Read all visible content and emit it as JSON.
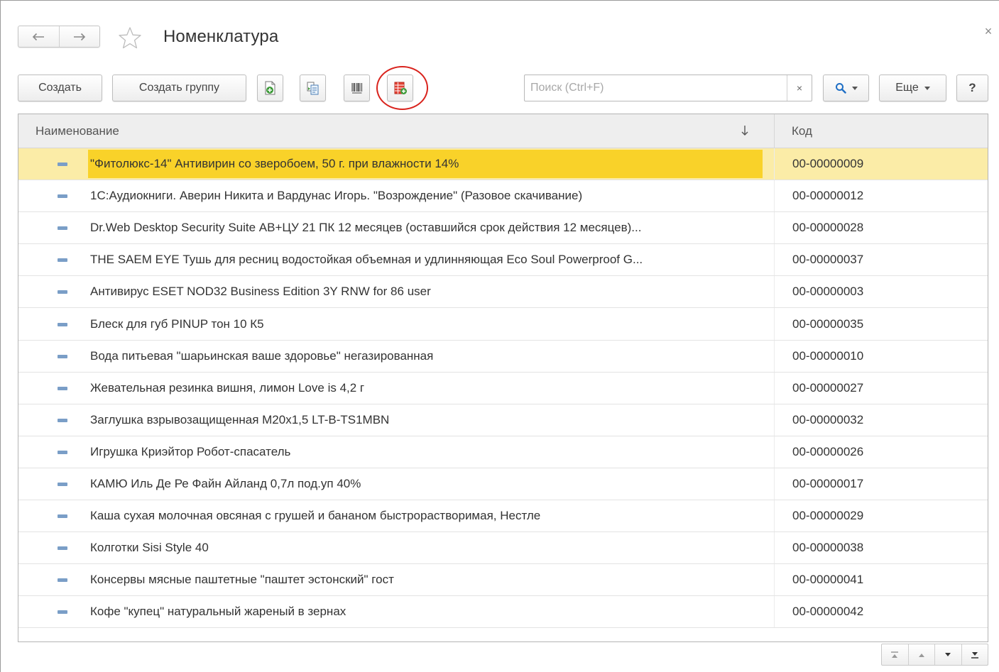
{
  "window": {
    "title": "Номенклатура",
    "close_label": "×"
  },
  "toolbar": {
    "create_label": "Создать",
    "create_group_label": "Создать группу",
    "search_placeholder": "Поиск (Ctrl+F)",
    "search_clear_label": "×",
    "more_label": "Еще",
    "help_label": "?"
  },
  "icons": {
    "back": "arrow-left-icon",
    "forward": "arrow-right-icon",
    "favorite": "star-icon",
    "add_copy": "document-add-icon",
    "copy": "copy-icon",
    "barcode": "barcode-icon",
    "load_from_file": "table-add-icon",
    "search": "magnifier-icon"
  },
  "colors": {
    "selected_row": "#fbeca7",
    "selected_cell": "#f9d229",
    "highlight_ring": "#d9231d",
    "item_marker": "#7a9ec7"
  },
  "table": {
    "columns": {
      "name": "Наименование",
      "code": "Код"
    },
    "rows": [
      {
        "name": "\"Фитолюкс-14\" Антивирин со зверобоем, 50 г. при влажности 14%",
        "code": "00-00000009"
      },
      {
        "name": "1С:Аудиокниги. Аверин Никита и Вардунас Игорь. \"Возрождение\" (Разовое скачивание)",
        "code": "00-00000012"
      },
      {
        "name": "Dr.Web Desktop Security Suite АВ+ЦУ 21 ПК 12 месяцев (оставшийся срок действия 12 месяцев)...",
        "code": "00-00000028"
      },
      {
        "name": "THE SAEM EYE Тушь для ресниц водостойкая объемная и удлинняющая Eco Soul Powerproof G...",
        "code": "00-00000037"
      },
      {
        "name": "Антивирус ESET NOD32 Business Edition 3Y RNW for 86 user",
        "code": "00-00000003"
      },
      {
        "name": "Блеск для губ PINUP тон 10 К5",
        "code": "00-00000035"
      },
      {
        "name": "Вода питьевая \"шарьинская ваше здоровье\" негазированная",
        "code": "00-00000010"
      },
      {
        "name": "Жевательная резинка вишня, лимон Love is 4,2 г",
        "code": "00-00000027"
      },
      {
        "name": "Заглушка взрывозащищенная М20х1,5 LT-B-TS1MBN",
        "code": "00-00000032"
      },
      {
        "name": "Игрушка Криэйтор Робот-спасатель",
        "code": "00-00000026"
      },
      {
        "name": "КАМЮ Иль Де Ре Файн Айланд 0,7л под.уп 40%",
        "code": "00-00000017"
      },
      {
        "name": "Каша сухая молочная овсяная с грушей и бананом быстрорастворимая, Нестле",
        "code": "00-00000029"
      },
      {
        "name": "Колготки Sisi Style 40",
        "code": "00-00000038"
      },
      {
        "name": "Консервы мясные паштетные \"паштет эстонский\" гост",
        "code": "00-00000041"
      },
      {
        "name": "Кофе \"купец\" натуральный жареный в зернах",
        "code": "00-00000042"
      }
    ],
    "selected_index": 0
  }
}
